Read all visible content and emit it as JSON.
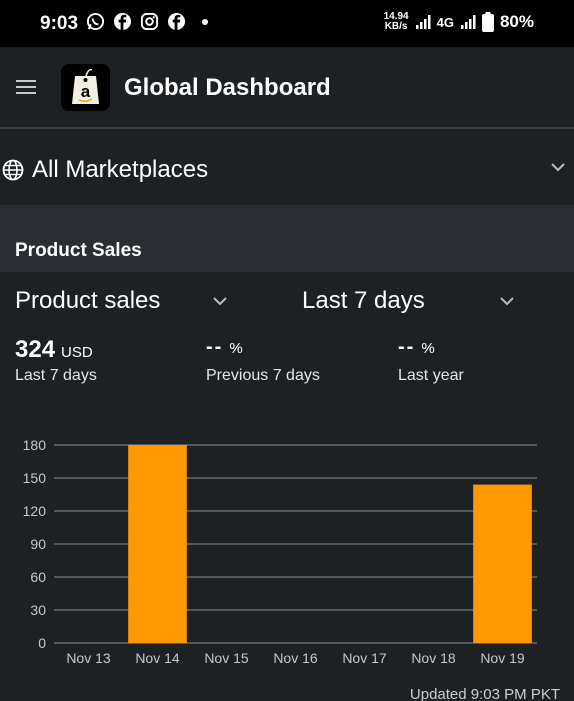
{
  "status_bar": {
    "time": "9:03",
    "notification_icons": [
      "whatsapp-icon",
      "facebook-icon",
      "instagram-icon",
      "facebook-icon"
    ],
    "net_speed_value": "14.94",
    "net_speed_unit": "KB/s",
    "network_type": "4G",
    "battery": "80%"
  },
  "app_bar": {
    "title": "Global Dashboard",
    "logo_letter": "a"
  },
  "marketplace": {
    "label": "All Marketplaces"
  },
  "card": {
    "title": "Product Sales",
    "metric_dropdown": "Product sales",
    "period_dropdown": "Last 7 days",
    "metrics": [
      {
        "value": "324",
        "unit": "USD",
        "caption": "Last 7 days"
      },
      {
        "value": "--",
        "unit": "%",
        "caption": "Previous 7 days"
      },
      {
        "value": "--",
        "unit": "%",
        "caption": "Last year"
      }
    ],
    "updated": "Updated 9:03 PM PKT"
  },
  "colors": {
    "background": "#1e2124",
    "band": "#2a2e32",
    "bar": "#ff9900",
    "grid": "#8a8d90"
  },
  "chart_data": {
    "type": "bar",
    "categories": [
      "Nov 13",
      "Nov 14",
      "Nov 15",
      "Nov 16",
      "Nov 17",
      "Nov 18",
      "Nov 19"
    ],
    "values": [
      0,
      180,
      0,
      0,
      0,
      0,
      144
    ],
    "y_ticks": [
      0,
      30,
      60,
      90,
      120,
      150,
      180
    ],
    "ylim": [
      0,
      180
    ],
    "grid": true,
    "bar_color": "#ff9900"
  }
}
